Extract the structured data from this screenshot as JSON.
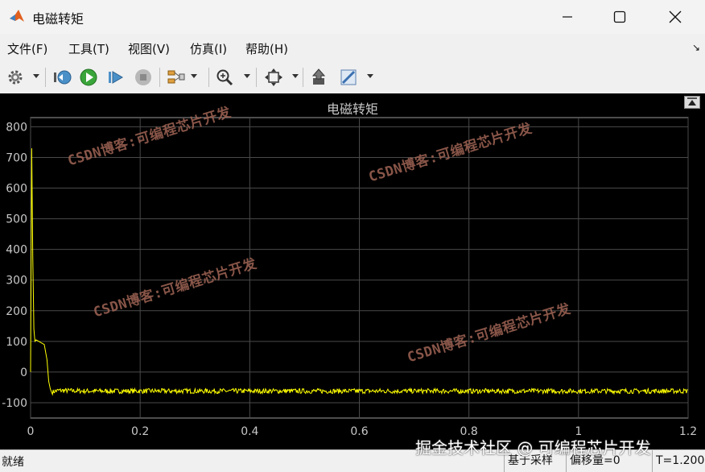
{
  "window": {
    "title": "电磁转矩",
    "controls": {
      "minimize_icon": "minimize-icon",
      "maximize_icon": "maximize-icon",
      "close_icon": "close-icon"
    }
  },
  "menu": {
    "items": [
      {
        "label": "文件(F)"
      },
      {
        "label": "工具(T)"
      },
      {
        "label": "视图(V)"
      },
      {
        "label": "仿真(I)"
      },
      {
        "label": "帮助(H)"
      }
    ]
  },
  "toolbar": {
    "icons": [
      "gear-icon",
      "step-back-icon",
      "run-icon",
      "step-forward-icon",
      "stop-icon",
      "signal-selector-icon",
      "zoom-icon",
      "fit-to-view-icon",
      "highlight-block-icon",
      "style-icon"
    ]
  },
  "chart_data": {
    "type": "line",
    "title": "电磁转矩",
    "xlabel": "",
    "ylabel": "",
    "xlim": [
      0,
      1.2
    ],
    "ylim": [
      -150,
      830
    ],
    "x_ticks": [
      "0",
      "0.2",
      "0.4",
      "0.6",
      "0.8",
      "1",
      "1.2"
    ],
    "y_ticks": [
      "800",
      "700",
      "600",
      "500",
      "400",
      "300",
      "200",
      "100",
      "0",
      "-100"
    ],
    "grid": true,
    "background": "#000000",
    "line_color": "#ffff00",
    "series": [
      {
        "x": [
          0,
          0.002,
          0.004,
          0.006,
          0.008,
          0.01,
          0.015,
          0.02,
          0.025,
          0.03,
          0.033,
          0.036,
          0.04,
          0.05,
          0.1,
          0.2,
          0.4,
          0.6,
          0.8,
          1.0,
          1.2
        ],
        "y": [
          0,
          730,
          380,
          140,
          100,
          105,
          100,
          95,
          90,
          40,
          -30,
          -55,
          -65,
          -60,
          -62,
          -62,
          -62,
          -62,
          -62,
          -62,
          -62
        ]
      }
    ],
    "noise_amplitude_after_transient": 8
  },
  "watermarks": [
    "CSDN博客:可编程芯片开发",
    "CSDN博客:可编程芯片开发",
    "CSDN博客:可编程芯片开发",
    "CSDN博客:可编程芯片开发"
  ],
  "overlay_text": "掘金技术社区 @ 可编程芯片开发",
  "statusbar": {
    "ready": "就绪",
    "sample_mode": "基于采样",
    "offset": "偏移量=0",
    "time": "T=1.200"
  },
  "colors": {
    "scope_bg": "#000000",
    "grid": "#4a4a4a",
    "trace": "#ffff00",
    "axis_text": "#c8c8c8"
  }
}
